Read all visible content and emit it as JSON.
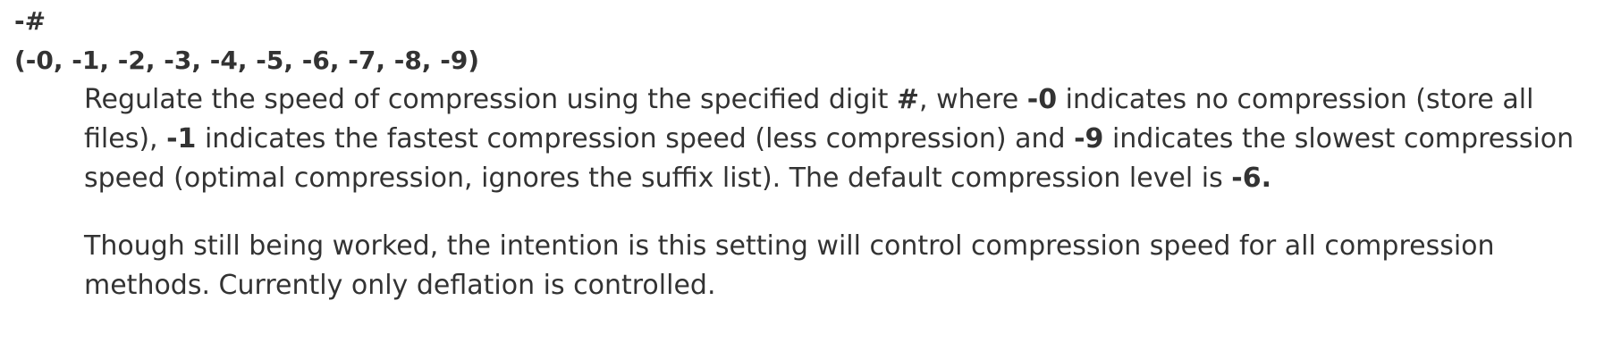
{
  "option": {
    "name": "-#",
    "variants": "(-0, -1, -2, -3, -4, -5, -6, -7, -8, -9)"
  },
  "description": {
    "p1": {
      "t1": "Regulate the speed of compression using the specified digit ",
      "b1": "#",
      "t2": ", where ",
      "b2": "-0",
      "t3": " indicates no compression (store all files), ",
      "b3": "-1",
      "t4": " indicates the fastest compression speed (less compression) and ",
      "b4": "-9",
      "t5": " indicates the slowest compression speed (optimal compression, ignores the suffix list). The default compression level is ",
      "b5": "-6."
    },
    "p2": "Though still being worked, the intention is this setting will control compression speed for all compression methods. Currently only deflation is controlled."
  }
}
